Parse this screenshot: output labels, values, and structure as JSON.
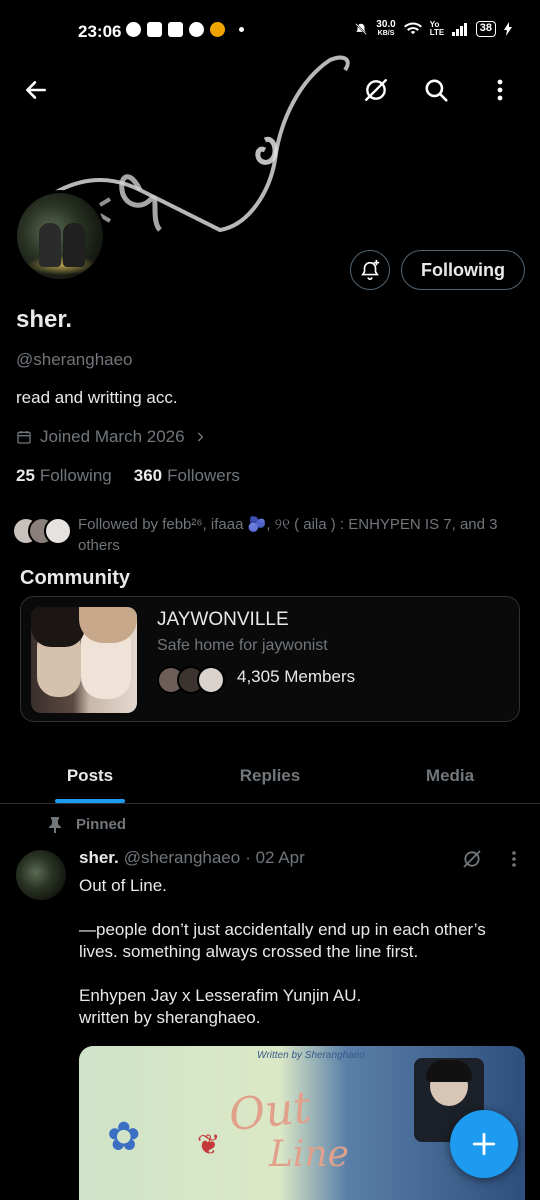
{
  "status_bar": {
    "time": "23:06",
    "speed_value": "30.0",
    "speed_unit": "KB/S",
    "network_label": "Yo LTE",
    "battery": "38"
  },
  "profile": {
    "name": "sher.",
    "handle": "@sheranghaeo",
    "bio": "read and writting acc.",
    "joined": "Joined March 2026",
    "following_count": "25",
    "following_label": "Following",
    "followers_count": "360",
    "followers_label": "Followers",
    "follow_button": "Following",
    "followed_by": "Followed by febb²⁶, ifaaa 🫐, ୨୧ ( aila ) : ENHYPEN IS 7, and 3 others"
  },
  "community": {
    "section_title": "Community",
    "name": "JAYWONVILLE",
    "description": "Safe home for jaywonist",
    "members": "4,305 Members"
  },
  "tabs": [
    {
      "label": "Posts",
      "active": true
    },
    {
      "label": "Replies",
      "active": false
    },
    {
      "label": "Media",
      "active": false
    }
  ],
  "post": {
    "pinned_label": "Pinned",
    "author_name": "sher.",
    "author_handle": "@sheranghaeo",
    "date": "· 02 Apr",
    "line1": "Out of Line.",
    "line2": "—people don’t just accidentally end up in each other’s lives. something always crossed the line first.",
    "line3": "Enhypen Jay x Lesserafim Yunjin AU.",
    "line4": "written by sheranghaeo.",
    "media_credit": "Written by Sheranghaeo",
    "media_title_1": "Out",
    "media_title_2": "Line"
  },
  "colors": {
    "accent": "#1d9bf0",
    "background": "#000000",
    "muted_text": "#71767b",
    "border": "#2f3336"
  },
  "icons": [
    "back-arrow-icon",
    "grok-icon",
    "search-icon",
    "more-vertical-icon",
    "bell-plus-icon",
    "calendar-icon",
    "chevron-right-icon",
    "pin-icon",
    "plus-icon"
  ]
}
